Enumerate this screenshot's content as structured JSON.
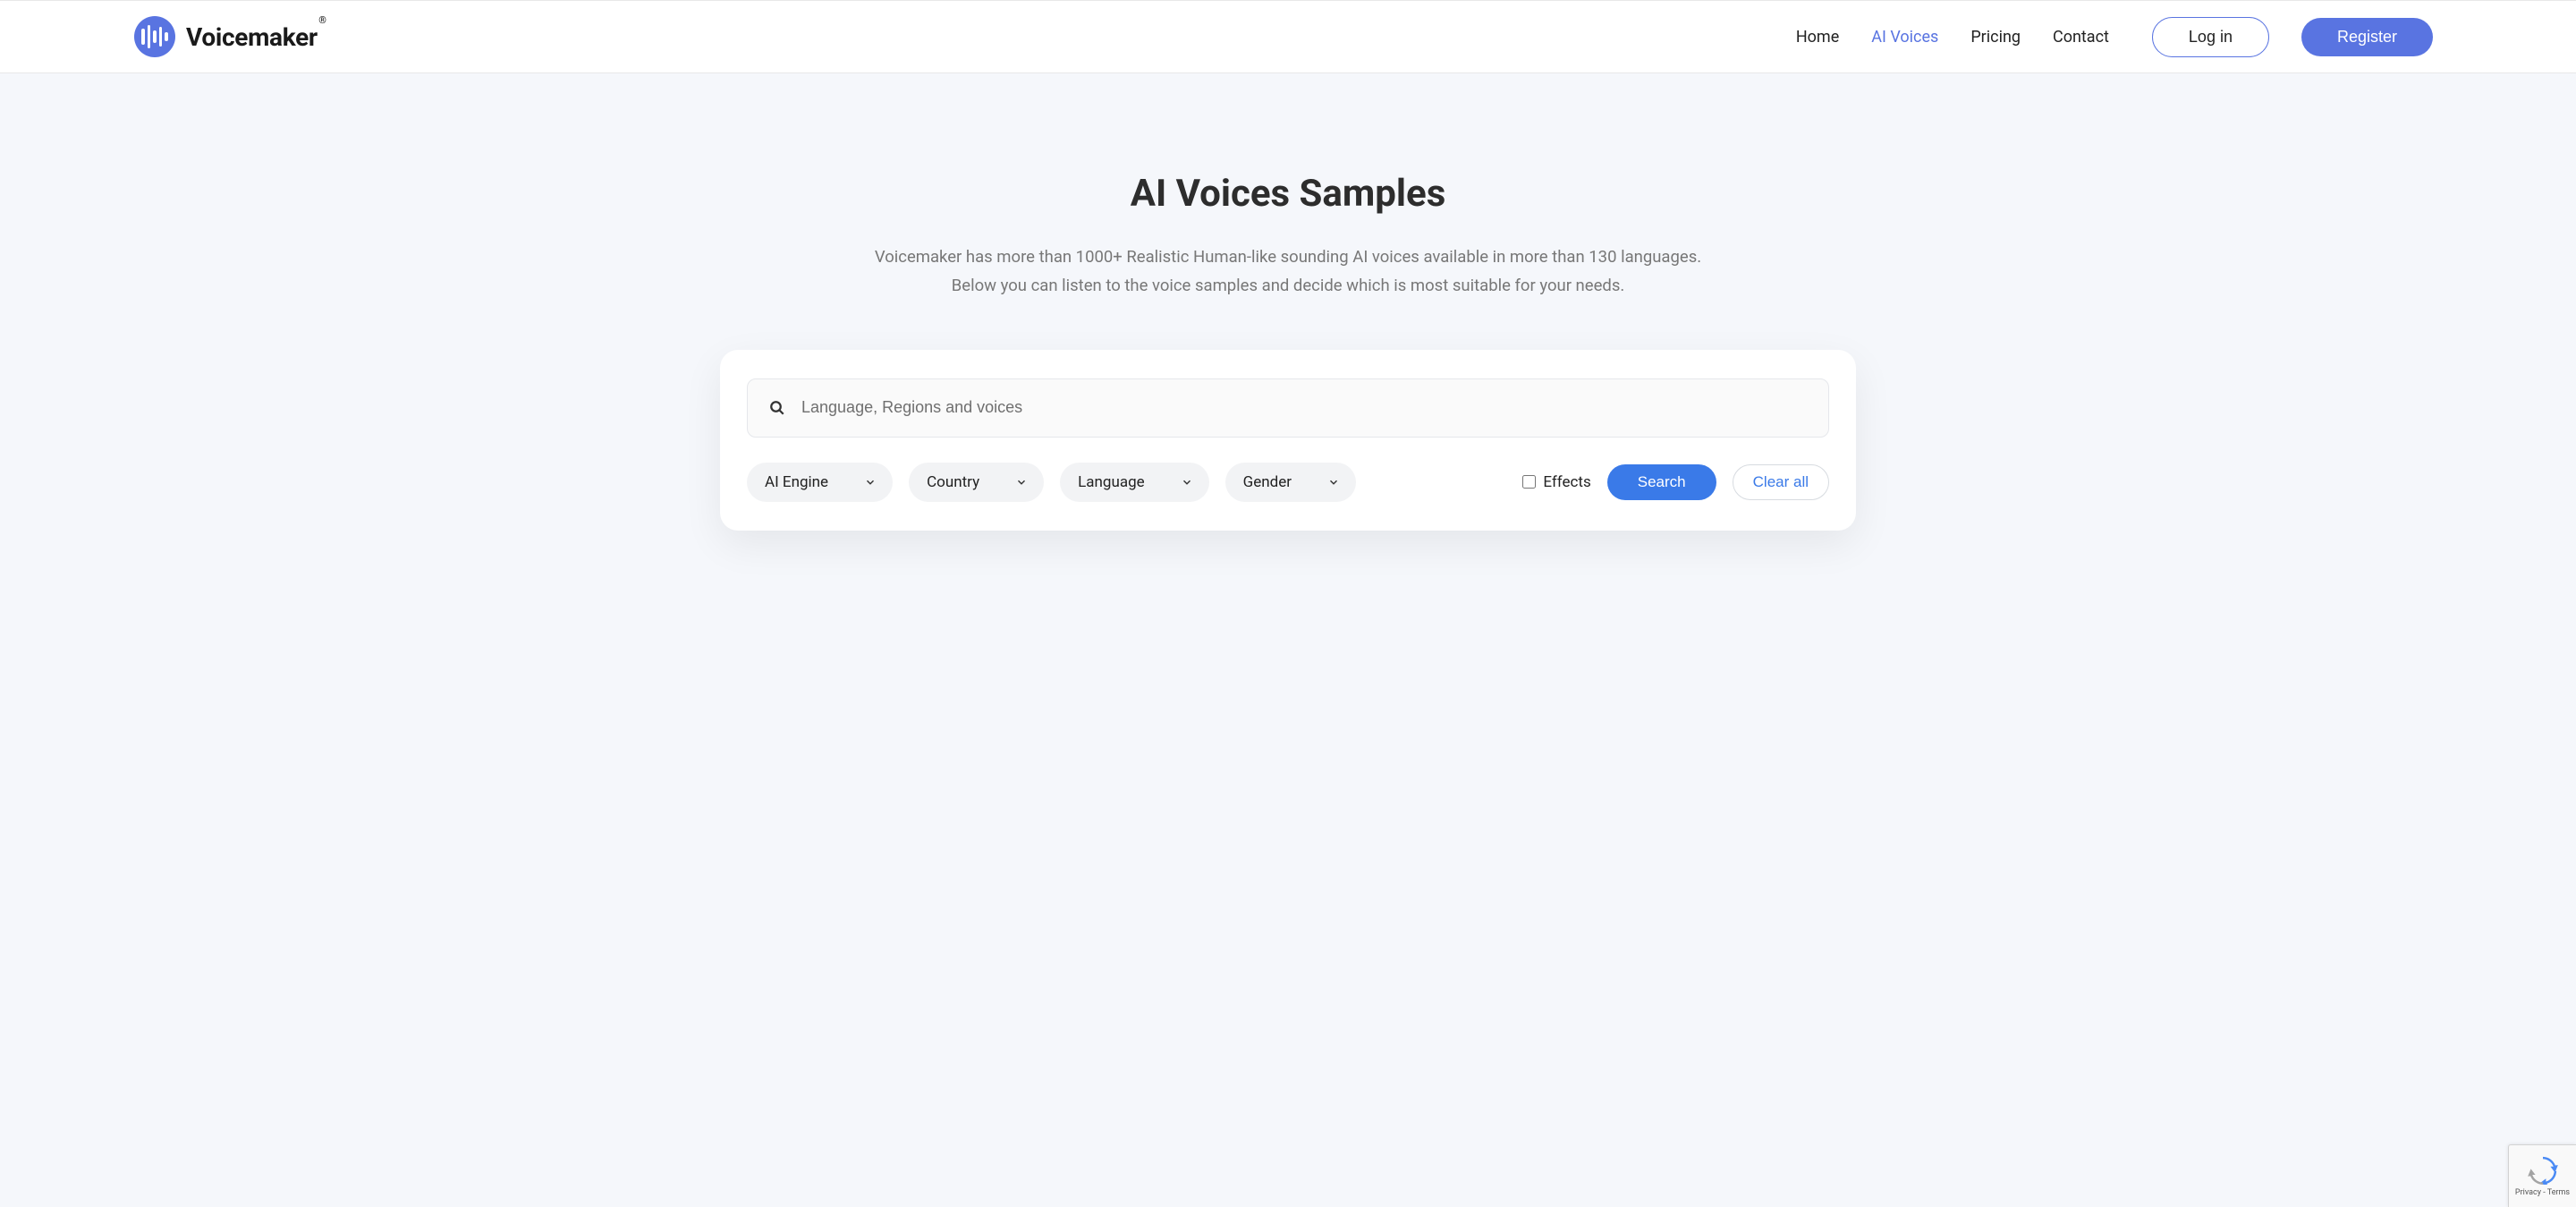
{
  "brand": {
    "name": "Voicemaker",
    "registered": "®"
  },
  "nav": {
    "home": "Home",
    "ai_voices": "AI Voices",
    "pricing": "Pricing",
    "contact": "Contact",
    "login": "Log in",
    "register": "Register"
  },
  "hero": {
    "title": "AI Voices Samples",
    "line1": "Voicemaker has more than 1000+ Realistic Human-like sounding AI voices available in more than 130 languages.",
    "line2": "Below you can listen to the voice samples and decide which is most suitable for your needs."
  },
  "search": {
    "placeholder": "Language, Regions and voices"
  },
  "filters": {
    "ai_engine": "AI Engine",
    "country": "Country",
    "language": "Language",
    "gender": "Gender",
    "effects": "Effects",
    "search_btn": "Search",
    "clear_btn": "Clear all"
  },
  "recaptcha": {
    "privacy": "Privacy",
    "terms": "Terms"
  }
}
